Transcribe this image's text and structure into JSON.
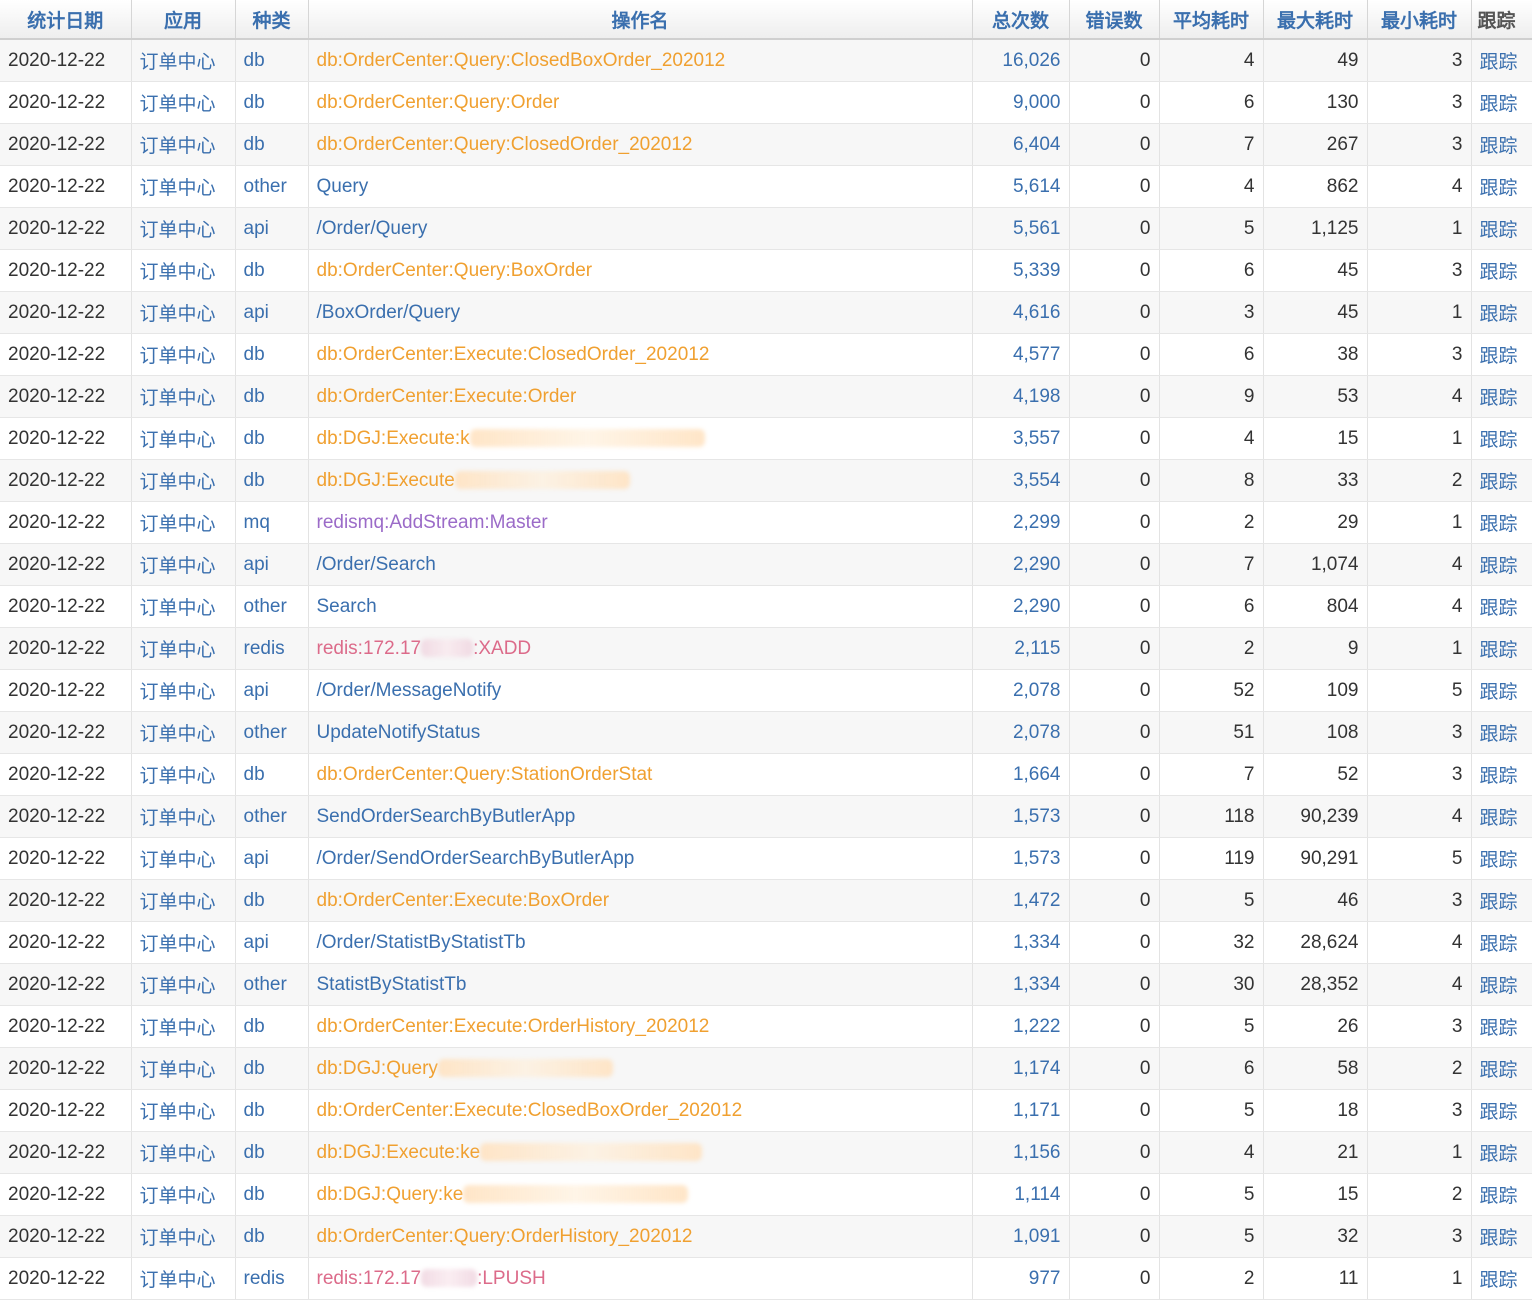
{
  "columns": {
    "date": "统计日期",
    "app": "应用",
    "kind": "种类",
    "op": "操作名",
    "total": "总次数",
    "errors": "错误数",
    "avg": "平均耗时",
    "max": "最大耗时",
    "min": "最小耗时",
    "trace": "跟踪"
  },
  "colors": {
    "header_text": "#3a6fae",
    "db": "#f0a030",
    "api": "#3a6fae",
    "other": "#3a6fae",
    "mq": "#9b6bc8",
    "redis": "#dc6b8a"
  },
  "rows": [
    {
      "date": "2020-12-22",
      "app": "订单中心",
      "kind": "db",
      "op": "db:OrderCenter:Query:ClosedBoxOrder_202012",
      "total": "16,026",
      "errors": "0",
      "avg": "4",
      "max": "49",
      "min": "3",
      "trace": "跟踪"
    },
    {
      "date": "2020-12-22",
      "app": "订单中心",
      "kind": "db",
      "op": "db:OrderCenter:Query:Order",
      "total": "9,000",
      "errors": "0",
      "avg": "6",
      "max": "130",
      "min": "3",
      "trace": "跟踪"
    },
    {
      "date": "2020-12-22",
      "app": "订单中心",
      "kind": "db",
      "op": "db:OrderCenter:Query:ClosedOrder_202012",
      "total": "6,404",
      "errors": "0",
      "avg": "7",
      "max": "267",
      "min": "3",
      "trace": "跟踪"
    },
    {
      "date": "2020-12-22",
      "app": "订单中心",
      "kind": "other",
      "op": "Query",
      "total": "5,614",
      "errors": "0",
      "avg": "4",
      "max": "862",
      "min": "4",
      "trace": "跟踪"
    },
    {
      "date": "2020-12-22",
      "app": "订单中心",
      "kind": "api",
      "op": "/Order/Query",
      "total": "5,561",
      "errors": "0",
      "avg": "5",
      "max": "1,125",
      "min": "1",
      "trace": "跟踪"
    },
    {
      "date": "2020-12-22",
      "app": "订单中心",
      "kind": "db",
      "op": "db:OrderCenter:Query:BoxOrder",
      "total": "5,339",
      "errors": "0",
      "avg": "6",
      "max": "45",
      "min": "3",
      "trace": "跟踪"
    },
    {
      "date": "2020-12-22",
      "app": "订单中心",
      "kind": "api",
      "op": "/BoxOrder/Query",
      "total": "4,616",
      "errors": "0",
      "avg": "3",
      "max": "45",
      "min": "1",
      "trace": "跟踪"
    },
    {
      "date": "2020-12-22",
      "app": "订单中心",
      "kind": "db",
      "op": "db:OrderCenter:Execute:ClosedOrder_202012",
      "total": "4,577",
      "errors": "0",
      "avg": "6",
      "max": "38",
      "min": "3",
      "trace": "跟踪"
    },
    {
      "date": "2020-12-22",
      "app": "订单中心",
      "kind": "db",
      "op": "db:OrderCenter:Execute:Order",
      "total": "4,198",
      "errors": "0",
      "avg": "9",
      "max": "53",
      "min": "4",
      "trace": "跟踪"
    },
    {
      "date": "2020-12-22",
      "app": "订单中心",
      "kind": "db",
      "op": "db:DGJ:Execute:k",
      "redacted": true,
      "total": "3,557",
      "errors": "0",
      "avg": "4",
      "max": "15",
      "min": "1",
      "trace": "跟踪"
    },
    {
      "date": "2020-12-22",
      "app": "订单中心",
      "kind": "db",
      "op": "db:DGJ:Execute",
      "redacted": true,
      "total": "3,554",
      "errors": "0",
      "avg": "8",
      "max": "33",
      "min": "2",
      "trace": "跟踪"
    },
    {
      "date": "2020-12-22",
      "app": "订单中心",
      "kind": "mq",
      "op": "redismq:AddStream:Master",
      "total": "2,299",
      "errors": "0",
      "avg": "2",
      "max": "29",
      "min": "1",
      "trace": "跟踪"
    },
    {
      "date": "2020-12-22",
      "app": "订单中心",
      "kind": "api",
      "op": "/Order/Search",
      "total": "2,290",
      "errors": "0",
      "avg": "7",
      "max": "1,074",
      "min": "4",
      "trace": "跟踪"
    },
    {
      "date": "2020-12-22",
      "app": "订单中心",
      "kind": "other",
      "op": "Search",
      "total": "2,290",
      "errors": "0",
      "avg": "6",
      "max": "804",
      "min": "4",
      "trace": "跟踪"
    },
    {
      "date": "2020-12-22",
      "app": "订单中心",
      "kind": "redis",
      "op": "redis:172.17",
      "op_suffix": ":XADD",
      "redacted": true,
      "total": "2,115",
      "errors": "0",
      "avg": "2",
      "max": "9",
      "min": "1",
      "trace": "跟踪"
    },
    {
      "date": "2020-12-22",
      "app": "订单中心",
      "kind": "api",
      "op": "/Order/MessageNotify",
      "total": "2,078",
      "errors": "0",
      "avg": "52",
      "max": "109",
      "min": "5",
      "trace": "跟踪"
    },
    {
      "date": "2020-12-22",
      "app": "订单中心",
      "kind": "other",
      "op": "UpdateNotifyStatus",
      "total": "2,078",
      "errors": "0",
      "avg": "51",
      "max": "108",
      "min": "3",
      "trace": "跟踪"
    },
    {
      "date": "2020-12-22",
      "app": "订单中心",
      "kind": "db",
      "op": "db:OrderCenter:Query:StationOrderStat",
      "total": "1,664",
      "errors": "0",
      "avg": "7",
      "max": "52",
      "min": "3",
      "trace": "跟踪"
    },
    {
      "date": "2020-12-22",
      "app": "订单中心",
      "kind": "other",
      "op": "SendOrderSearchByButlerApp",
      "total": "1,573",
      "errors": "0",
      "avg": "118",
      "max": "90,239",
      "min": "4",
      "trace": "跟踪"
    },
    {
      "date": "2020-12-22",
      "app": "订单中心",
      "kind": "api",
      "op": "/Order/SendOrderSearchByButlerApp",
      "total": "1,573",
      "errors": "0",
      "avg": "119",
      "max": "90,291",
      "min": "5",
      "trace": "跟踪"
    },
    {
      "date": "2020-12-22",
      "app": "订单中心",
      "kind": "db",
      "op": "db:OrderCenter:Execute:BoxOrder",
      "total": "1,472",
      "errors": "0",
      "avg": "5",
      "max": "46",
      "min": "3",
      "trace": "跟踪"
    },
    {
      "date": "2020-12-22",
      "app": "订单中心",
      "kind": "api",
      "op": "/Order/StatistByStatistTb",
      "total": "1,334",
      "errors": "0",
      "avg": "32",
      "max": "28,624",
      "min": "4",
      "trace": "跟踪"
    },
    {
      "date": "2020-12-22",
      "app": "订单中心",
      "kind": "other",
      "op": "StatistByStatistTb",
      "total": "1,334",
      "errors": "0",
      "avg": "30",
      "max": "28,352",
      "min": "4",
      "trace": "跟踪"
    },
    {
      "date": "2020-12-22",
      "app": "订单中心",
      "kind": "db",
      "op": "db:OrderCenter:Execute:OrderHistory_202012",
      "total": "1,222",
      "errors": "0",
      "avg": "5",
      "max": "26",
      "min": "3",
      "trace": "跟踪"
    },
    {
      "date": "2020-12-22",
      "app": "订单中心",
      "kind": "db",
      "op": "db:DGJ:Query",
      "redacted": true,
      "total": "1,174",
      "errors": "0",
      "avg": "6",
      "max": "58",
      "min": "2",
      "trace": "跟踪"
    },
    {
      "date": "2020-12-22",
      "app": "订单中心",
      "kind": "db",
      "op": "db:OrderCenter:Execute:ClosedBoxOrder_202012",
      "total": "1,171",
      "errors": "0",
      "avg": "5",
      "max": "18",
      "min": "3",
      "trace": "跟踪"
    },
    {
      "date": "2020-12-22",
      "app": "订单中心",
      "kind": "db",
      "op": "db:DGJ:Execute:ke",
      "redacted": true,
      "total": "1,156",
      "errors": "0",
      "avg": "4",
      "max": "21",
      "min": "1",
      "trace": "跟踪"
    },
    {
      "date": "2020-12-22",
      "app": "订单中心",
      "kind": "db",
      "op": "db:DGJ:Query:ke",
      "redacted": true,
      "total": "1,114",
      "errors": "0",
      "avg": "5",
      "max": "15",
      "min": "2",
      "trace": "跟踪"
    },
    {
      "date": "2020-12-22",
      "app": "订单中心",
      "kind": "db",
      "op": "db:OrderCenter:Query:OrderHistory_202012",
      "total": "1,091",
      "errors": "0",
      "avg": "5",
      "max": "32",
      "min": "3",
      "trace": "跟踪"
    },
    {
      "date": "2020-12-22",
      "app": "订单中心",
      "kind": "redis",
      "op": "redis:172.17",
      "op_suffix": ":LPUSH",
      "redacted": true,
      "total": "977",
      "errors": "0",
      "avg": "2",
      "max": "11",
      "min": "1",
      "trace": "跟踪"
    }
  ]
}
